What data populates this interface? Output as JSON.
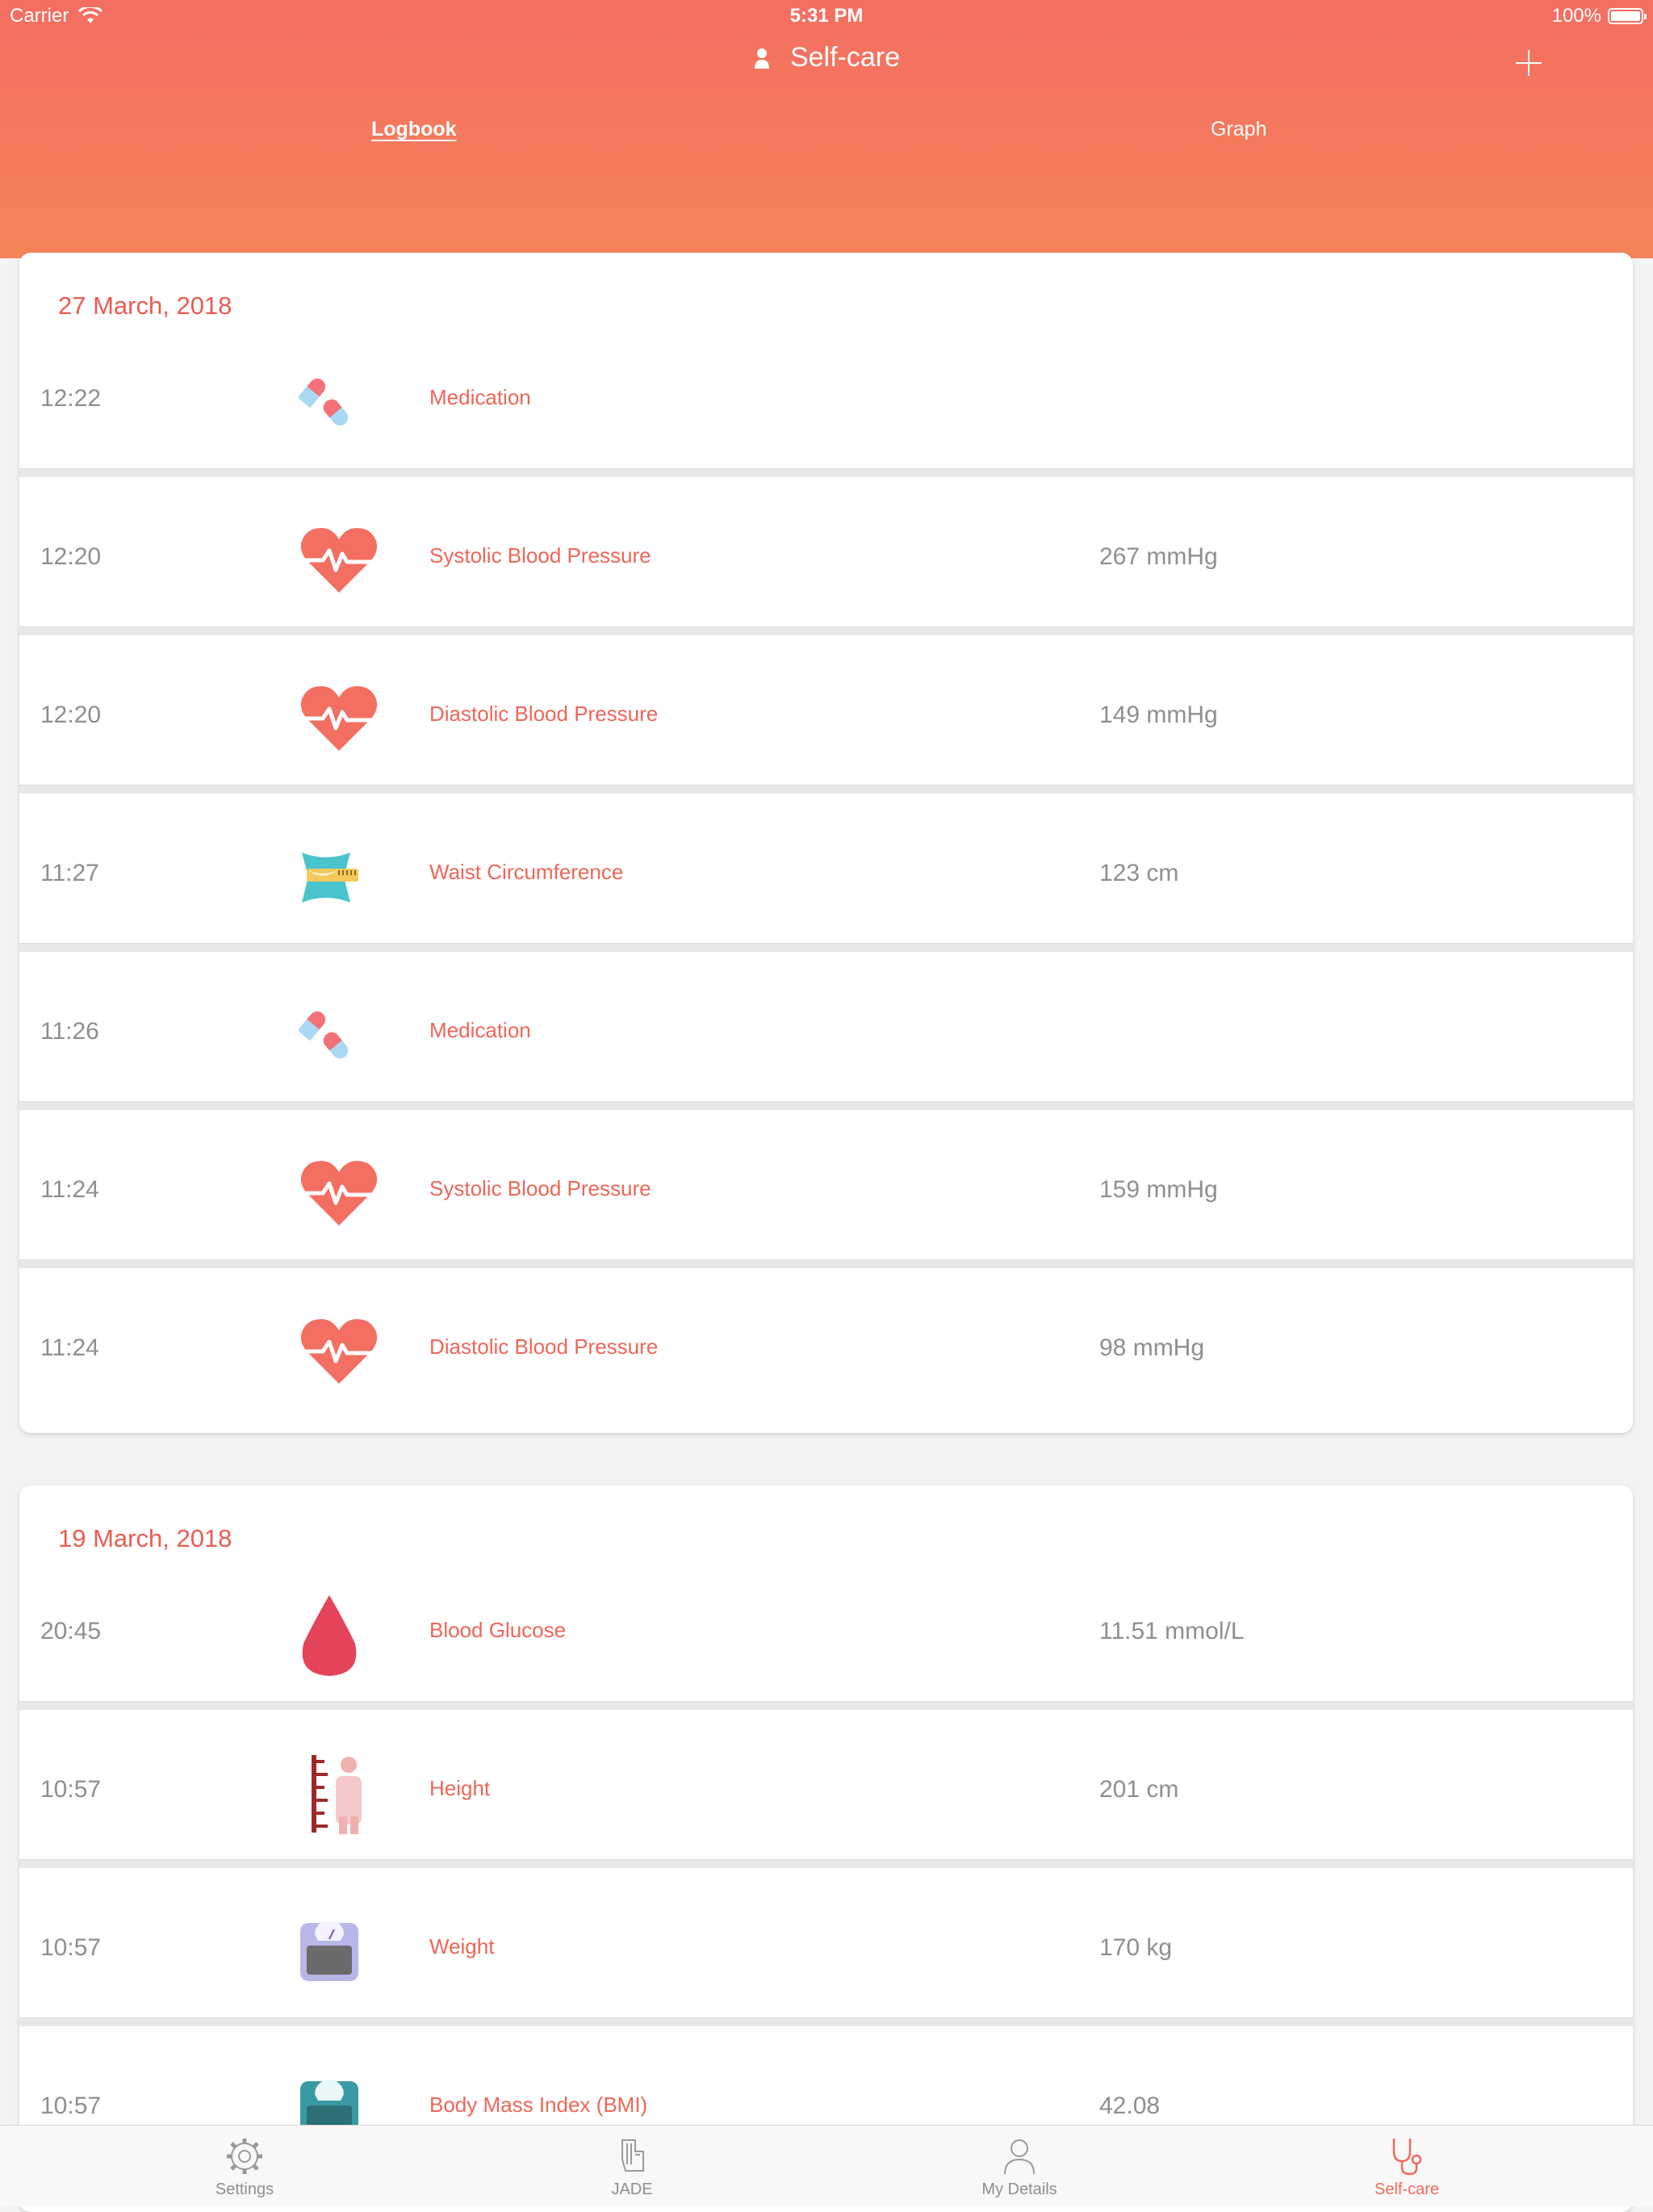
{
  "status_bar": {
    "carrier": "Carrier",
    "time": "5:31 PM",
    "battery": "100%",
    "battery_level": 1.0
  },
  "header": {
    "title": "Self-care",
    "tabs": {
      "logbook": "Logbook",
      "graph": "Graph"
    }
  },
  "days": [
    {
      "date": "27 March, 2018",
      "entries": [
        {
          "time": "12:22",
          "icon": "pills-icon",
          "label": "Medication",
          "value": ""
        },
        {
          "time": "12:20",
          "icon": "heart-pulse-icon",
          "label": "Systolic Blood Pressure",
          "value": "267 mmHg"
        },
        {
          "time": "12:20",
          "icon": "heart-pulse-icon",
          "label": "Diastolic Blood Pressure",
          "value": "149 mmHg"
        },
        {
          "time": "11:27",
          "icon": "tape-measure-icon",
          "label": "Waist Circumference",
          "value": "123 cm"
        },
        {
          "time": "11:26",
          "icon": "pills-icon",
          "label": "Medication",
          "value": ""
        },
        {
          "time": "11:24",
          "icon": "heart-pulse-icon",
          "label": "Systolic Blood Pressure",
          "value": "159 mmHg"
        },
        {
          "time": "11:24",
          "icon": "heart-pulse-icon",
          "label": "Diastolic Blood Pressure",
          "value": "98 mmHg"
        }
      ]
    },
    {
      "date": "19 March, 2018",
      "entries": [
        {
          "time": "20:45",
          "icon": "blood-drop-icon",
          "label": "Blood Glucose",
          "value": "11.51 mmol/L"
        },
        {
          "time": "10:57",
          "icon": "height-icon",
          "label": "Height",
          "value": "201 cm"
        },
        {
          "time": "10:57",
          "icon": "scale-icon",
          "label": "Weight",
          "value": "170 kg"
        },
        {
          "time": "10:57",
          "icon": "bmi-scale-icon",
          "label": "Body Mass Index (BMI)",
          "value": "42.08"
        }
      ]
    }
  ],
  "tabbar": [
    {
      "label": "Settings",
      "icon": "gear-icon"
    },
    {
      "label": "JADE",
      "icon": "jade-hand-icon"
    },
    {
      "label": "My Details",
      "icon": "person-icon"
    },
    {
      "label": "Self-care",
      "icon": "stethoscope-icon",
      "active": true
    }
  ],
  "colors": {
    "header_top": "#f46e62",
    "header_bottom": "#f5845a",
    "accent": "#ef6658",
    "muted": "#8e8e93"
  }
}
